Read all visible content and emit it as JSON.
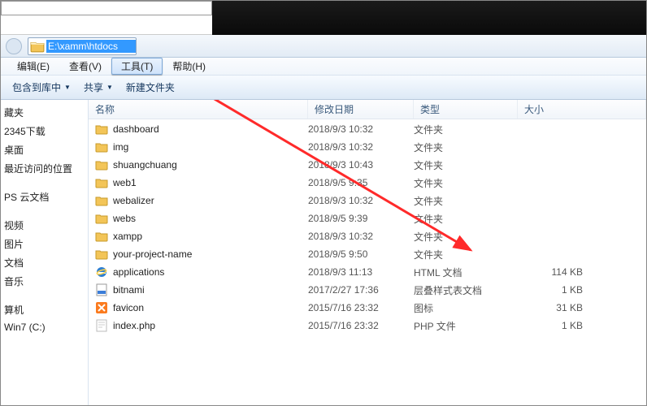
{
  "address": {
    "path": "E:\\xamm\\htdocs"
  },
  "menus": {
    "edit": "编辑(E)",
    "view": "查看(V)",
    "tools": "工具(T)",
    "help": "帮助(H)"
  },
  "toolbar": {
    "include": "包含到库中",
    "share": "共享",
    "newfolder": "新建文件夹"
  },
  "sidebar": {
    "items": [
      "藏夹",
      "2345下载",
      "桌面",
      "最近访问的位置",
      "",
      "PS 云文档",
      "",
      "视频",
      "图片",
      "文档",
      "音乐",
      "",
      "算机",
      "Win7 (C:)"
    ]
  },
  "columns": {
    "name": "名称",
    "date": "修改日期",
    "type": "类型",
    "size": "大小"
  },
  "files": [
    {
      "icon": "folder",
      "name": "dashboard",
      "date": "2018/9/3 10:32",
      "type": "文件夹",
      "size": ""
    },
    {
      "icon": "folder",
      "name": "img",
      "date": "2018/9/3 10:32",
      "type": "文件夹",
      "size": ""
    },
    {
      "icon": "folder",
      "name": "shuangchuang",
      "date": "2018/9/3 10:43",
      "type": "文件夹",
      "size": ""
    },
    {
      "icon": "folder",
      "name": "web1",
      "date": "2018/9/5 9:35",
      "type": "文件夹",
      "size": ""
    },
    {
      "icon": "folder",
      "name": "webalizer",
      "date": "2018/9/3 10:32",
      "type": "文件夹",
      "size": ""
    },
    {
      "icon": "folder",
      "name": "webs",
      "date": "2018/9/5 9:39",
      "type": "文件夹",
      "size": ""
    },
    {
      "icon": "folder",
      "name": "xampp",
      "date": "2018/9/3 10:32",
      "type": "文件夹",
      "size": ""
    },
    {
      "icon": "folder",
      "name": "your-project-name",
      "date": "2018/9/5 9:50",
      "type": "文件夹",
      "size": ""
    },
    {
      "icon": "ie",
      "name": "applications",
      "date": "2018/9/3 11:13",
      "type": "HTML 文档",
      "size": "114 KB"
    },
    {
      "icon": "css",
      "name": "bitnami",
      "date": "2017/2/27 17:36",
      "type": "层叠样式表文档",
      "size": "1 KB"
    },
    {
      "icon": "xa",
      "name": "favicon",
      "date": "2015/7/16 23:32",
      "type": "图标",
      "size": "31 KB"
    },
    {
      "icon": "php",
      "name": "index.php",
      "date": "2015/7/16 23:32",
      "type": "PHP 文件",
      "size": "1 KB"
    }
  ]
}
